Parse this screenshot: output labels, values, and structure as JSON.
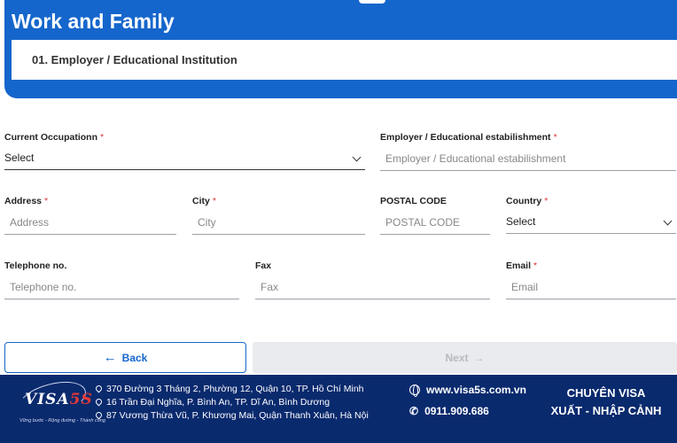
{
  "header": {
    "title": "Work and Family",
    "section": "01. Employer / Educational Institution"
  },
  "form": {
    "occupation": {
      "label": "Current Occupationn",
      "value": "Select"
    },
    "employer": {
      "label": "Employer / Educational estabilishment",
      "placeholder": "Employer / Educational estabilishment"
    },
    "address": {
      "label": "Address",
      "placeholder": "Address"
    },
    "city": {
      "label": "City",
      "placeholder": "City"
    },
    "postal": {
      "label": "POSTAL CODE",
      "placeholder": "POSTAL CODE"
    },
    "country": {
      "label": "Country",
      "value": "Select"
    },
    "telephone": {
      "label": "Telephone no.",
      "placeholder": "Telephone no."
    },
    "fax": {
      "label": "Fax",
      "placeholder": "Fax"
    },
    "email": {
      "label": "Email",
      "placeholder": "Email"
    },
    "required_mark": "*"
  },
  "buttons": {
    "back": "Back",
    "next": "Next",
    "back_icon": "arrow-left-icon",
    "next_icon": "arrow-right-icon"
  },
  "footer": {
    "logo": "VISA5S",
    "logo_tagline": "Vững bước - Rộng đường - Thành công",
    "addresses": [
      "370 Đường 3 Tháng 2, Phường 12, Quận 10, TP. Hồ Chí Minh",
      "16 Trần Đại Nghĩa, P. Bình An, TP. Dĩ An, Bình Dương",
      "87 Vương Thừa Vũ, P. Khương Mai, Quận Thanh Xuân, Hà Nội"
    ],
    "website": "www.visa5s.com.vn",
    "phone": "0911.909.686",
    "slogan_line1": "CHUYÊN VISA",
    "slogan_line2": "XUẤT - NHẬP CẢNH"
  },
  "colors": {
    "primary": "#1566cc",
    "footer_bg": "#0a2a6e",
    "required": "#dd3333"
  }
}
